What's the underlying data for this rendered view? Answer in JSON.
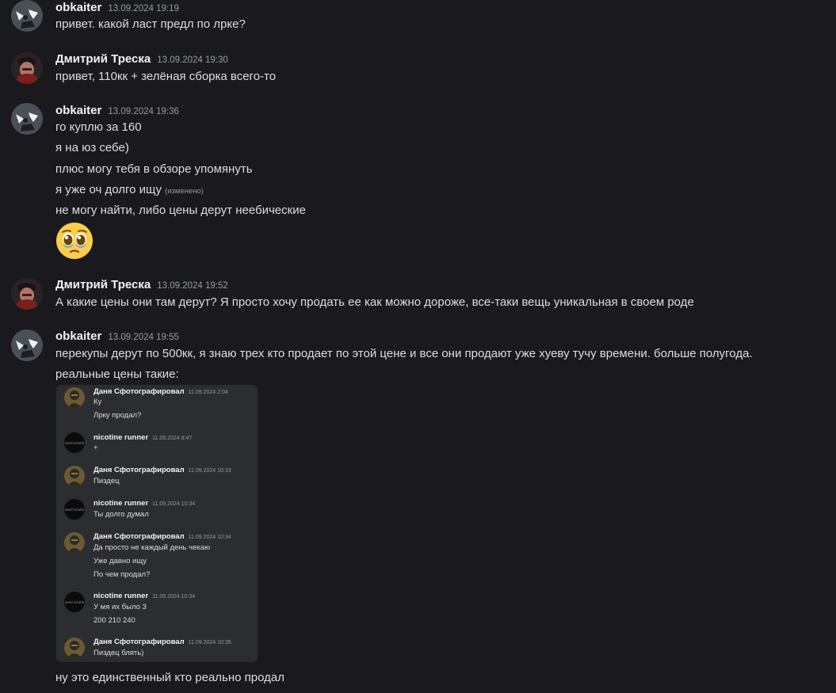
{
  "messages": [
    {
      "author": "obkaiter",
      "timestamp": "13.09.2024 19:19",
      "lines": [
        "привет. какой ласт предл по лрке?"
      ]
    },
    {
      "author": "Дмитрий Треска",
      "timestamp": "13.09.2024 19:30",
      "lines": [
        "привет, 110кк + зелёная сборка всего-то"
      ]
    },
    {
      "author": "obkaiter",
      "timestamp": "13.09.2024 19:36",
      "lines": [
        "го куплю за 160",
        "я на юз себе)",
        "плюс могу тебя в обзоре упомянуть",
        "я уже оч долго ищу",
        "не могу найти, либо цены дерут неебические"
      ],
      "edited_label": "(изменено)",
      "emoji": "pleading-face"
    },
    {
      "author": "Дмитрий Треска",
      "timestamp": "13.09.2024 19:52",
      "lines": [
        "А какие цены они там дерут? Я просто хочу продать ее как можно дороже, все-таки вещь уникальная в своем роде"
      ]
    },
    {
      "author": "obkaiter",
      "timestamp": "13.09.2024 19:55",
      "lines": [
        "перекупы дерут по 500кк, я знаю трех кто продает по этой цене и все они продают уже хуеву тучу времени. больше полугода.",
        "реальные цены такие:",
        "ну это единственный кто реально продал"
      ]
    }
  ],
  "embed": {
    "messages": [
      {
        "author": "Даня Сфотографировал",
        "timestamp": "11.09.2024 2:04",
        "lines": [
          "Ку",
          "Лрку продал?"
        ]
      },
      {
        "author": "nicotine runner",
        "timestamp": "11.09.2024 8:47",
        "lines": [
          "+"
        ]
      },
      {
        "author": "Даня Сфотографировал",
        "timestamp": "11.09.2024 10:33",
        "lines": [
          "Пиздец"
        ]
      },
      {
        "author": "nicotine runner",
        "timestamp": "11.09.2024 10:34",
        "lines": [
          "Ты долго думал"
        ]
      },
      {
        "author": "Даня Сфотографировал",
        "timestamp": "11.09.2024 10:34",
        "lines": [
          "Да просто не каждый день чекаю",
          "Уже давно ищу",
          "По чем продал?"
        ]
      },
      {
        "author": "nicotine runner",
        "timestamp": "11.09.2024 10:34",
        "lines": [
          "У мя их было 3",
          "200 210 240"
        ]
      },
      {
        "author": "Даня Сфотографировал",
        "timestamp": "11.09.2024 10:35",
        "lines": [
          "Пиздец блять)"
        ]
      }
    ]
  },
  "colors": {
    "background": "#1a1a1e",
    "embed_background": "#2b2d31",
    "author": "#f2f3f5",
    "timestamp": "#949ba4",
    "text": "#dbdee1"
  }
}
